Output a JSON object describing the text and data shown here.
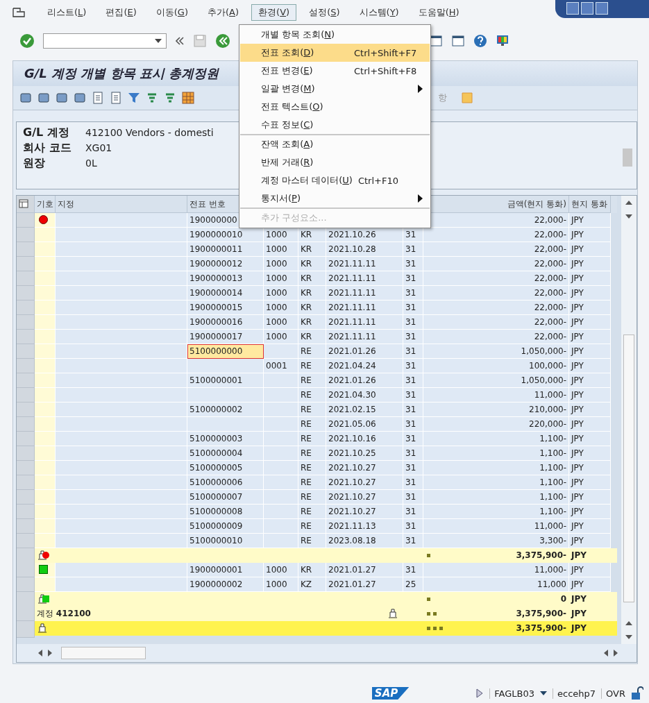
{
  "menu_bar": [
    {
      "label": "리스트(L)",
      "selected": false
    },
    {
      "label": "편집(E)",
      "selected": false
    },
    {
      "label": "이동(G)",
      "selected": false
    },
    {
      "label": "추가(A)",
      "selected": false
    },
    {
      "label": "환경(V)",
      "selected": true
    },
    {
      "label": "설정(S)",
      "selected": false
    },
    {
      "label": "시스템(Y)",
      "selected": false
    },
    {
      "label": "도움말(H)",
      "selected": false
    }
  ],
  "dropdown": [
    {
      "label": "개별 항목 조회(N)",
      "selected": false,
      "submenu": false,
      "disabled": false,
      "separator_before": false
    },
    {
      "label": "전표 조회(D)",
      "shortcut": "Ctrl+Shift+F7",
      "selected": true,
      "submenu": false,
      "disabled": false,
      "separator_before": false
    },
    {
      "label": "전표 변경(E)",
      "shortcut": "Ctrl+Shift+F8",
      "selected": false,
      "submenu": false,
      "disabled": false,
      "separator_before": false
    },
    {
      "label": "일괄 변경(M)",
      "selected": false,
      "submenu": true,
      "disabled": false,
      "separator_before": false
    },
    {
      "label": "전표 텍스트(O)",
      "selected": false,
      "submenu": false,
      "disabled": false,
      "separator_before": false
    },
    {
      "label": "수표 정보(C)",
      "selected": false,
      "submenu": false,
      "disabled": false,
      "separator_before": false
    },
    {
      "label": "잔액 조회(A)",
      "selected": false,
      "submenu": false,
      "disabled": false,
      "separator_before": true
    },
    {
      "label": "반제 거래(R)",
      "selected": false,
      "submenu": false,
      "disabled": false,
      "separator_before": false
    },
    {
      "label": "계정 마스터 데이터(U)",
      "shortcut": "Ctrl+F10",
      "selected": false,
      "submenu": false,
      "disabled": false,
      "separator_before": false
    },
    {
      "label": "통지서(P)",
      "selected": false,
      "submenu": true,
      "disabled": false,
      "separator_before": false
    },
    {
      "label": "추가 구성요소...",
      "selected": false,
      "submenu": false,
      "disabled": true,
      "separator_before": true
    }
  ],
  "title": "G/L 계정 개별 항목 표시 총계정원",
  "app_toolbar_fragment": "항",
  "header": [
    {
      "label": "G/L 계정",
      "value": "412100 Vendors - domesti"
    },
    {
      "label": "회사 코드",
      "value": "XG01"
    },
    {
      "label": "원장",
      "value": "0L"
    }
  ],
  "table": {
    "headers": {
      "symbol": "기호",
      "assignment": "지정",
      "doc_no": "전표 번호",
      "amount": "금액(현지 통화)",
      "currency": "현지 통화"
    },
    "rows": [
      {
        "kind": "item",
        "cleared": false,
        "doc_no": "190000000",
        "selected": false,
        "amount": "22,000-",
        "currency": "JPY"
      },
      {
        "kind": "item",
        "doc_no": "1900000010",
        "company": "1000",
        "type": "KR",
        "date": "2021.10.26",
        "period": "31",
        "selected": false,
        "amount": "22,000-",
        "currency": "JPY"
      },
      {
        "kind": "item",
        "doc_no": "1900000011",
        "company": "1000",
        "type": "KR",
        "date": "2021.10.28",
        "period": "31",
        "selected": false,
        "amount": "22,000-",
        "currency": "JPY"
      },
      {
        "kind": "item",
        "doc_no": "1900000012",
        "company": "1000",
        "type": "KR",
        "date": "2021.11.11",
        "period": "31",
        "selected": false,
        "amount": "22,000-",
        "currency": "JPY"
      },
      {
        "kind": "item",
        "doc_no": "1900000013",
        "company": "1000",
        "type": "KR",
        "date": "2021.11.11",
        "period": "31",
        "selected": false,
        "amount": "22,000-",
        "currency": "JPY"
      },
      {
        "kind": "item",
        "doc_no": "1900000014",
        "company": "1000",
        "type": "KR",
        "date": "2021.11.11",
        "period": "31",
        "selected": false,
        "amount": "22,000-",
        "currency": "JPY"
      },
      {
        "kind": "item",
        "doc_no": "1900000015",
        "company": "1000",
        "type": "KR",
        "date": "2021.11.11",
        "period": "31",
        "selected": false,
        "amount": "22,000-",
        "currency": "JPY"
      },
      {
        "kind": "item",
        "doc_no": "1900000016",
        "company": "1000",
        "type": "KR",
        "date": "2021.11.11",
        "period": "31",
        "selected": false,
        "amount": "22,000-",
        "currency": "JPY"
      },
      {
        "kind": "item",
        "doc_no": "1900000017",
        "company": "1000",
        "type": "KR",
        "date": "2021.11.11",
        "period": "31",
        "selected": false,
        "amount": "22,000-",
        "currency": "JPY"
      },
      {
        "kind": "item",
        "doc_no": "5100000000",
        "type": "RE",
        "date": "2021.01.26",
        "period": "31",
        "selected": true,
        "amount": "1,050,000-",
        "currency": "JPY"
      },
      {
        "kind": "item",
        "company": "0001",
        "type": "RE",
        "date": "2021.04.24",
        "period": "31",
        "selected": false,
        "amount": "100,000-",
        "currency": "JPY"
      },
      {
        "kind": "item",
        "doc_no": "5100000001",
        "type": "RE",
        "date": "2021.01.26",
        "period": "31",
        "selected": false,
        "amount": "1,050,000-",
        "currency": "JPY"
      },
      {
        "kind": "item",
        "type": "RE",
        "date": "2021.04.30",
        "period": "31",
        "selected": false,
        "amount": "11,000-",
        "currency": "JPY"
      },
      {
        "kind": "item",
        "doc_no": "5100000002",
        "type": "RE",
        "date": "2021.02.15",
        "period": "31",
        "selected": false,
        "amount": "210,000-",
        "currency": "JPY"
      },
      {
        "kind": "item",
        "type": "RE",
        "date": "2021.05.06",
        "period": "31",
        "selected": false,
        "amount": "220,000-",
        "currency": "JPY"
      },
      {
        "kind": "item",
        "doc_no": "5100000003",
        "type": "RE",
        "date": "2021.10.16",
        "period": "31",
        "selected": false,
        "amount": "1,100-",
        "currency": "JPY"
      },
      {
        "kind": "item",
        "doc_no": "5100000004",
        "type": "RE",
        "date": "2021.10.25",
        "period": "31",
        "selected": false,
        "amount": "1,100-",
        "currency": "JPY"
      },
      {
        "kind": "item",
        "doc_no": "5100000005",
        "type": "RE",
        "date": "2021.10.27",
        "period": "31",
        "selected": false,
        "amount": "1,100-",
        "currency": "JPY"
      },
      {
        "kind": "item",
        "doc_no": "5100000006",
        "type": "RE",
        "date": "2021.10.27",
        "period": "31",
        "selected": false,
        "amount": "1,100-",
        "currency": "JPY"
      },
      {
        "kind": "item",
        "doc_no": "5100000007",
        "type": "RE",
        "date": "2021.10.27",
        "period": "31",
        "selected": false,
        "amount": "1,100-",
        "currency": "JPY"
      },
      {
        "kind": "item",
        "doc_no": "5100000008",
        "type": "RE",
        "date": "2021.10.27",
        "period": "31",
        "selected": false,
        "amount": "1,100-",
        "currency": "JPY"
      },
      {
        "kind": "item",
        "doc_no": "5100000009",
        "type": "RE",
        "date": "2021.11.13",
        "period": "31",
        "selected": false,
        "amount": "11,000-",
        "currency": "JPY"
      },
      {
        "kind": "item",
        "doc_no": "5100000010",
        "type": "RE",
        "date": "2023.08.18",
        "period": "31",
        "selected": false,
        "amount": "3,300-",
        "currency": "JPY"
      },
      {
        "kind": "subtotal",
        "cleared": false,
        "amount": "3,375,900-",
        "currency": "JPY"
      },
      {
        "kind": "item",
        "cleared": true,
        "doc_no": "1900000001",
        "company": "1000",
        "type": "KR",
        "date": "2021.01.27",
        "period": "31",
        "selected": false,
        "amount": "11,000-",
        "currency": "JPY"
      },
      {
        "kind": "item",
        "doc_no": "1900000002",
        "company": "1000",
        "type": "KZ",
        "date": "2021.01.27",
        "period": "25",
        "selected": false,
        "amount": "11,000",
        "currency": "JPY"
      },
      {
        "kind": "subtotal",
        "cleared": true,
        "amount": "0",
        "currency": "JPY"
      },
      {
        "kind": "account_total",
        "label": "계정 **412100**",
        "amount": "3,375,900-",
        "currency": "JPY"
      },
      {
        "kind": "grand_total",
        "amount": "3,375,900-",
        "currency": "JPY"
      }
    ]
  },
  "status_bar": {
    "logo": "SAP",
    "transaction": "FAGLB03",
    "system": "eccehp7",
    "mode": "OVR"
  }
}
